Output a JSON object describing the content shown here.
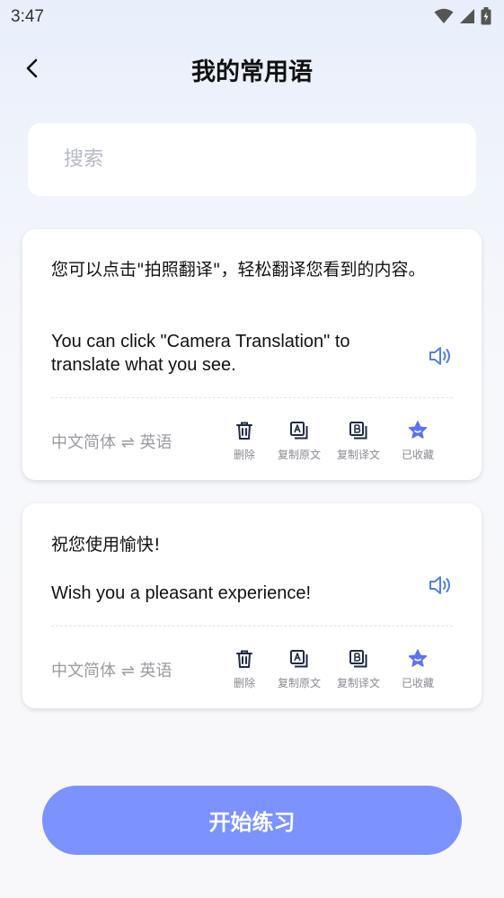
{
  "status_bar": {
    "time": "3:47"
  },
  "header": {
    "title": "我的常用语"
  },
  "search": {
    "placeholder": "搜索",
    "value": ""
  },
  "phrases": [
    {
      "source": "您可以点击\"拍照翻译\"，轻松翻译您看到的内容。",
      "translation": "You can click \"Camera Translation\" to translate what you see.",
      "language_pair": "中文简体 ⇌ 英语"
    },
    {
      "source": "祝您使用愉快!",
      "translation": "Wish you a pleasant experience!",
      "language_pair": "中文简体 ⇌ 英语"
    }
  ],
  "actions": {
    "delete": "删除",
    "copy_source": "复制原文",
    "copy_translation": "复制译文",
    "favorited": "已收藏"
  },
  "start_button": {
    "label": "开始练习"
  },
  "colors": {
    "accent": "#7b92ff",
    "icon_dark": "#1f2a44",
    "speaker": "#4f7fe8",
    "star": "#5d72f0"
  },
  "icons": {
    "back": "chevron-left-icon",
    "speaker": "speaker-icon",
    "delete": "trash-icon",
    "copy_source": "copy-a-icon",
    "copy_translation": "copy-b-icon",
    "favorited": "star-filled-icon"
  }
}
